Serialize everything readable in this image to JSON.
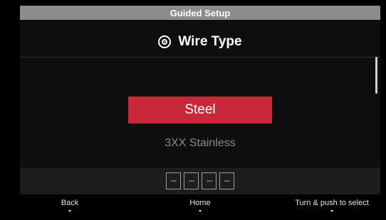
{
  "header": {
    "title": "Guided Setup"
  },
  "page": {
    "title": "Wire Type",
    "icon": "wire-spool-icon"
  },
  "options": {
    "selected": "Steel",
    "next": "3XX Stainless"
  },
  "code": [
    "---",
    "---",
    "---",
    "---"
  ],
  "footer": {
    "back_label": "Back",
    "home_label": "Home",
    "select_label": "Turn & push to select"
  },
  "colors": {
    "header_bar": "#8c8c8c",
    "selected_highlight": "#c8283a",
    "background": "#0e0e0e"
  }
}
